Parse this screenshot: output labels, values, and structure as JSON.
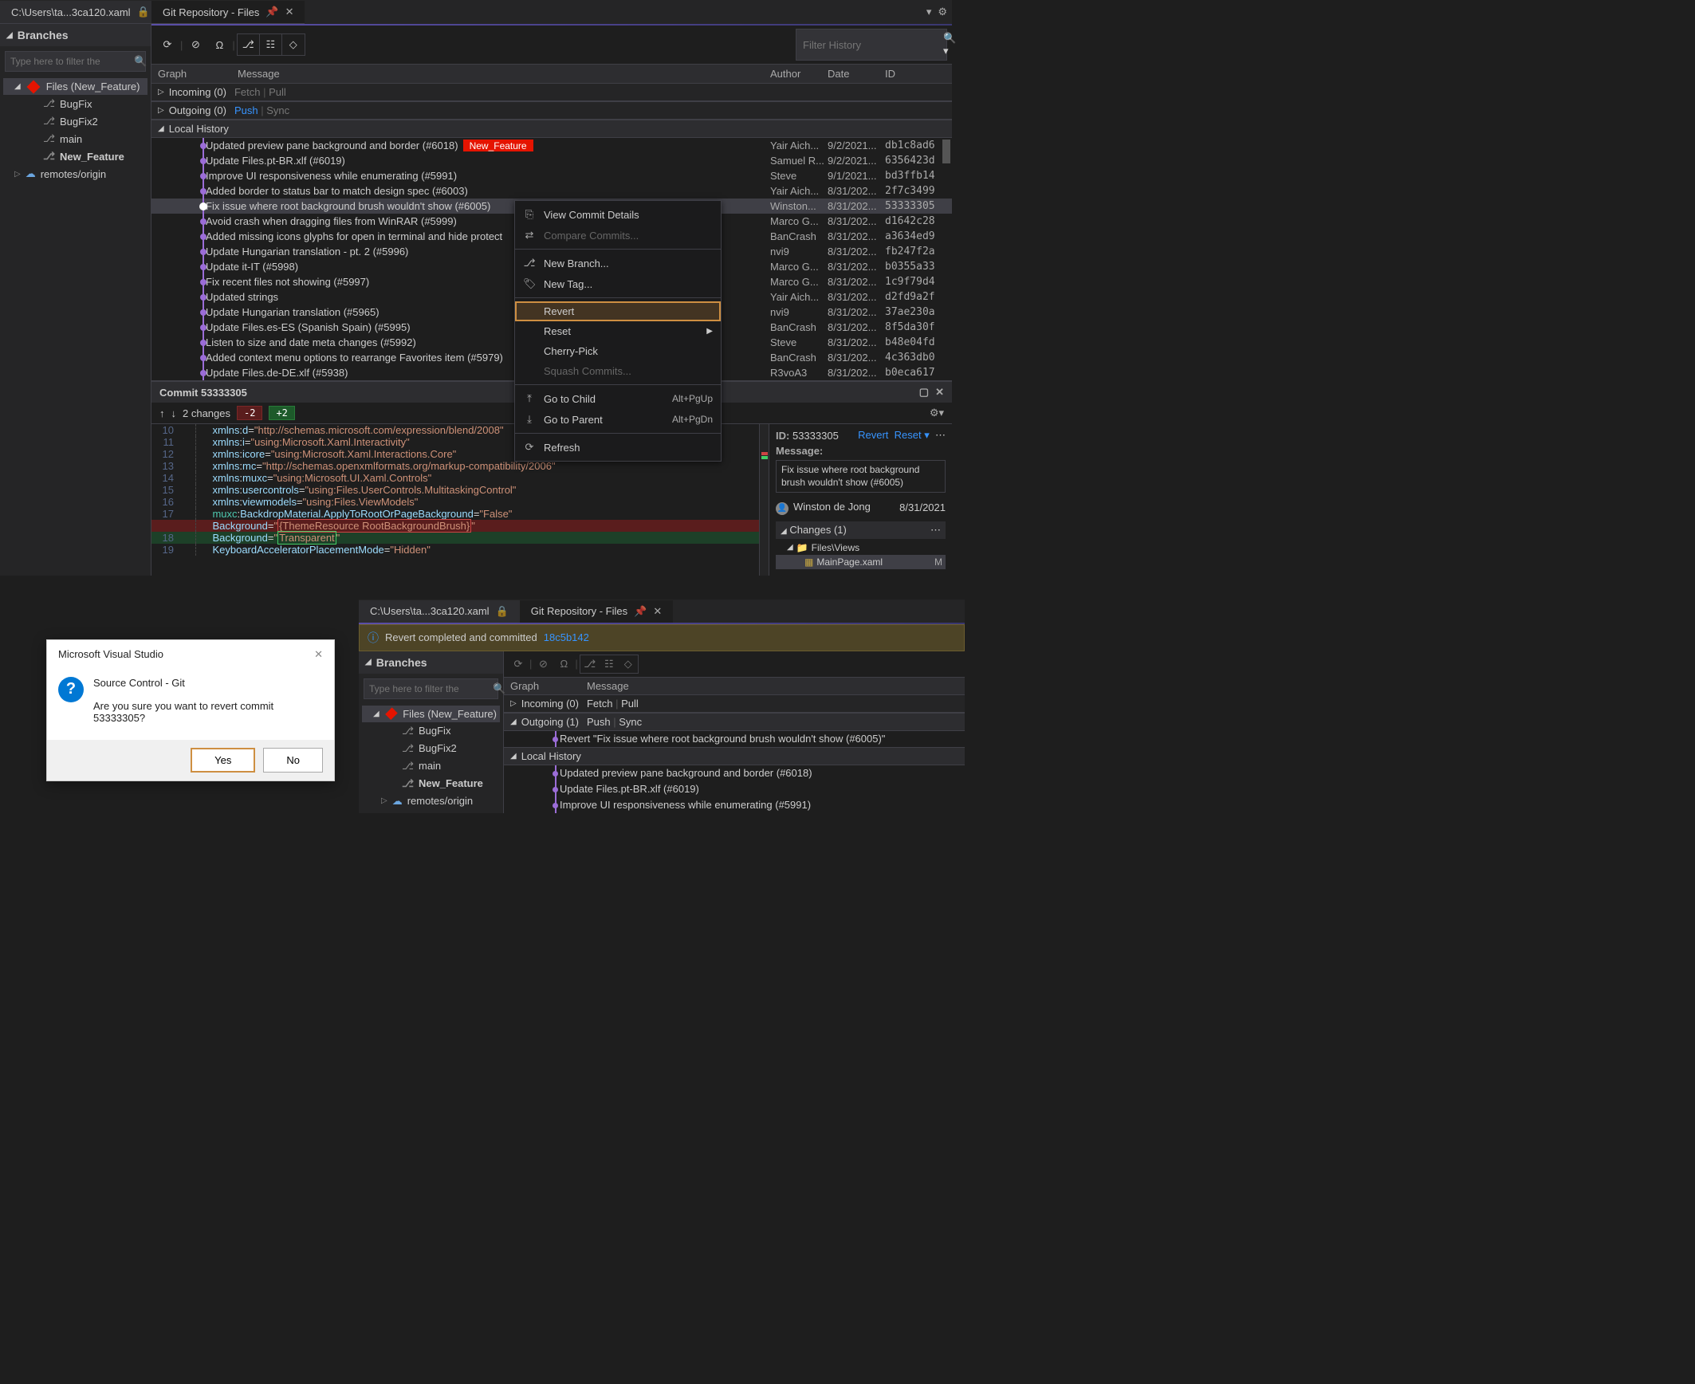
{
  "tabs": {
    "file_tab": "C:\\Users\\ta...3ca120.xaml",
    "git_tab": "Git Repository - Files"
  },
  "sidebar": {
    "header": "Branches",
    "search_placeholder": "Type here to filter the",
    "root": "Files (New_Feature)",
    "items": [
      "BugFix",
      "BugFix2",
      "main",
      "New_Feature"
    ],
    "remotes": "remotes/origin"
  },
  "filter": {
    "placeholder": "Filter History"
  },
  "history_header": {
    "graph": "Graph",
    "message": "Message",
    "author": "Author",
    "date": "Date",
    "id": "ID"
  },
  "sections": {
    "incoming": "Incoming (0)",
    "outgoing": "Outgoing (0)",
    "local": "Local History",
    "incoming_links": {
      "fetch": "Fetch",
      "pull": "Pull"
    },
    "outgoing_links": {
      "push": "Push",
      "sync": "Sync"
    }
  },
  "tag_label": "New_Feature",
  "commits": [
    {
      "msg": "Updated preview pane background and border (#6018)",
      "author": "Yair Aich...",
      "date": "9/2/2021...",
      "id": "db1c8ad6",
      "tag": true
    },
    {
      "msg": "Update Files.pt-BR.xlf (#6019)",
      "author": "Samuel R...",
      "date": "9/2/2021...",
      "id": "6356423d"
    },
    {
      "msg": "Improve UI responsiveness while enumerating (#5991)",
      "author": "Steve",
      "date": "9/1/2021...",
      "id": "bd3ffb14"
    },
    {
      "msg": "Added border to status bar to match design spec (#6003)",
      "author": "Yair Aich...",
      "date": "8/31/202...",
      "id": "2f7c3499"
    },
    {
      "msg": "Fix issue where root background brush wouldn't show (#6005)",
      "author": "Winston...",
      "date": "8/31/202...",
      "id": "53333305",
      "selected": true
    },
    {
      "msg": " Avoid crash when dragging files from WinRAR (#5999)",
      "author": "Marco G...",
      "date": "8/31/202...",
      "id": "d1642c28"
    },
    {
      "msg": "Added missing icons glyphs for open in terminal and hide protect",
      "author": "BanCrash",
      "date": "8/31/202...",
      "id": "a3634ed9"
    },
    {
      "msg": "Update Hungarian translation - pt. 2 (#5996)",
      "author": "nvi9",
      "date": "8/31/202...",
      "id": "fb247f2a"
    },
    {
      "msg": "Update it-IT (#5998)",
      "author": "Marco G...",
      "date": "8/31/202...",
      "id": "b0355a33"
    },
    {
      "msg": "Fix recent files not showing (#5997)",
      "author": "Marco G...",
      "date": "8/31/202...",
      "id": "1c9f79d4"
    },
    {
      "msg": "Updated strings",
      "author": "Yair Aich...",
      "date": "8/31/202...",
      "id": "d2fd9a2f"
    },
    {
      "msg": "Update Hungarian translation (#5965)",
      "author": "nvi9",
      "date": "8/31/202...",
      "id": "37ae230a"
    },
    {
      "msg": "Update Files.es-ES (Spanish Spain) (#5995)",
      "author": "BanCrash",
      "date": "8/31/202...",
      "id": "8f5da30f"
    },
    {
      "msg": "Listen to size and date meta changes (#5992)",
      "author": "Steve",
      "date": "8/31/202...",
      "id": "b48e04fd"
    },
    {
      "msg": "Added context menu options to rearrange Favorites item (#5979)",
      "author": "BanCrash",
      "date": "8/31/202...",
      "id": "4c363db0"
    },
    {
      "msg": "Update Files.de-DE.xlf (#5938)",
      "author": "R3voA3",
      "date": "8/31/202...",
      "id": "b0eca617"
    }
  ],
  "context_menu": {
    "items": [
      {
        "label": "View Commit Details",
        "icon": "⎘"
      },
      {
        "label": "Compare Commits...",
        "icon": "⇄",
        "disabled": true
      },
      {
        "sep": true
      },
      {
        "label": "New Branch...",
        "icon": "⎇"
      },
      {
        "label": "New Tag...",
        "icon": "🏷"
      },
      {
        "sep": true
      },
      {
        "label": "Revert",
        "selected": true
      },
      {
        "label": "Reset",
        "sub": true
      },
      {
        "label": "Cherry-Pick"
      },
      {
        "label": "Squash Commits...",
        "disabled": true
      },
      {
        "sep": true
      },
      {
        "label": "Go to Child",
        "kb": "Alt+PgUp",
        "icon": "⤒"
      },
      {
        "label": "Go to Parent",
        "kb": "Alt+PgDn",
        "icon": "⤓"
      },
      {
        "sep": true
      },
      {
        "label": "Refresh",
        "icon": "⟳"
      }
    ]
  },
  "diff": {
    "title": "Commit 53333305",
    "changes_label": "2 changes",
    "del_count": "-2",
    "add_count": "+2",
    "side": {
      "id_label": "ID:",
      "id": "53333305",
      "revert": "Revert",
      "reset": "Reset ▾",
      "msg_label": "Message:",
      "msg": "Fix issue where root background brush wouldn't show (#6005)",
      "user": "Winston de Jong",
      "date": "8/31/2021",
      "changes_hdr": "Changes (1)",
      "folder": "Files\\Views",
      "file": "MainPage.xaml",
      "file_badge": "M"
    }
  },
  "dialog": {
    "title": "Microsoft Visual Studio",
    "header": "Source Control - Git",
    "body": "Are you sure you want to revert commit 53333305?",
    "yes": "Yes",
    "no": "No"
  },
  "after": {
    "file_tab": "C:\\Users\\ta...3ca120.xaml",
    "git_tab": "Git Repository - Files",
    "info_msg": "Revert completed and committed",
    "info_commit": "18c5b142",
    "sidebar": {
      "header": "Branches",
      "search_placeholder": "Type here to filter the",
      "root": "Files (New_Feature)",
      "items": [
        "BugFix",
        "BugFix2",
        "main",
        "New_Feature"
      ],
      "remotes": "remotes/origin"
    },
    "sections": {
      "incoming": "Incoming (0)",
      "outgoing": "Outgoing (1)",
      "local": "Local History"
    },
    "outgoing_commit": "Revert \"Fix issue where root background brush wouldn't show (#6005)\"",
    "commits": [
      "Updated preview pane background and border (#6018)",
      "Update Files.pt-BR.xlf (#6019)",
      "Improve UI responsiveness while enumerating (#5991)"
    ]
  }
}
